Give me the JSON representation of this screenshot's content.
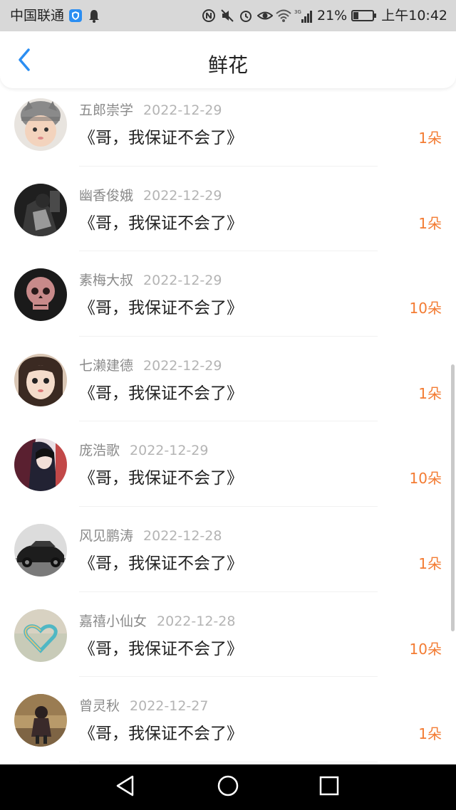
{
  "status_bar": {
    "carrier": "中国联通",
    "network": "3G",
    "battery": "21%",
    "time": "上午10:42",
    "icons": [
      "shield-icon",
      "bell-icon",
      "nfc-icon",
      "mute-icon",
      "alarm-icon",
      "eye-icon",
      "wifi-icon",
      "signal-icon",
      "battery-icon"
    ]
  },
  "header": {
    "back_icon": "chevron-left-icon",
    "title": "鲜花"
  },
  "colors": {
    "count": "#f37b32",
    "back": "#2b8ef2"
  },
  "items": [
    {
      "name": "五郎崇学",
      "date": "2022-12-29",
      "message": "《哥，我保证不会了》",
      "count": "1朵",
      "avatar": "baby-photo"
    },
    {
      "name": "幽香俊娥",
      "date": "2022-12-29",
      "message": "《哥，我保证不会了》",
      "count": "1朵",
      "avatar": "dark-photo"
    },
    {
      "name": "素梅大叔",
      "date": "2022-12-29",
      "message": "《哥，我保证不会了》",
      "count": "10朵",
      "avatar": "skull-art"
    },
    {
      "name": "七濑建德",
      "date": "2022-12-29",
      "message": "《哥，我保证不会了》",
      "count": "1朵",
      "avatar": "girl-photo"
    },
    {
      "name": "庞浩歌",
      "date": "2022-12-29",
      "message": "《哥，我保证不会了》",
      "count": "10朵",
      "avatar": "anime-art"
    },
    {
      "name": "风见鹏涛",
      "date": "2022-12-28",
      "message": "《哥，我保证不会了》",
      "count": "1朵",
      "avatar": "car-photo"
    },
    {
      "name": "嘉禧小仙女",
      "date": "2022-12-28",
      "message": "《哥，我保证不会了》",
      "count": "10朵",
      "avatar": "heart-photo"
    },
    {
      "name": "曾灵秋",
      "date": "2022-12-27",
      "message": "《哥，我保证不会了》",
      "count": "1朵",
      "avatar": "street-photo"
    }
  ],
  "nav": {
    "icons": [
      "back-triangle-icon",
      "home-circle-icon",
      "recents-square-icon"
    ]
  }
}
